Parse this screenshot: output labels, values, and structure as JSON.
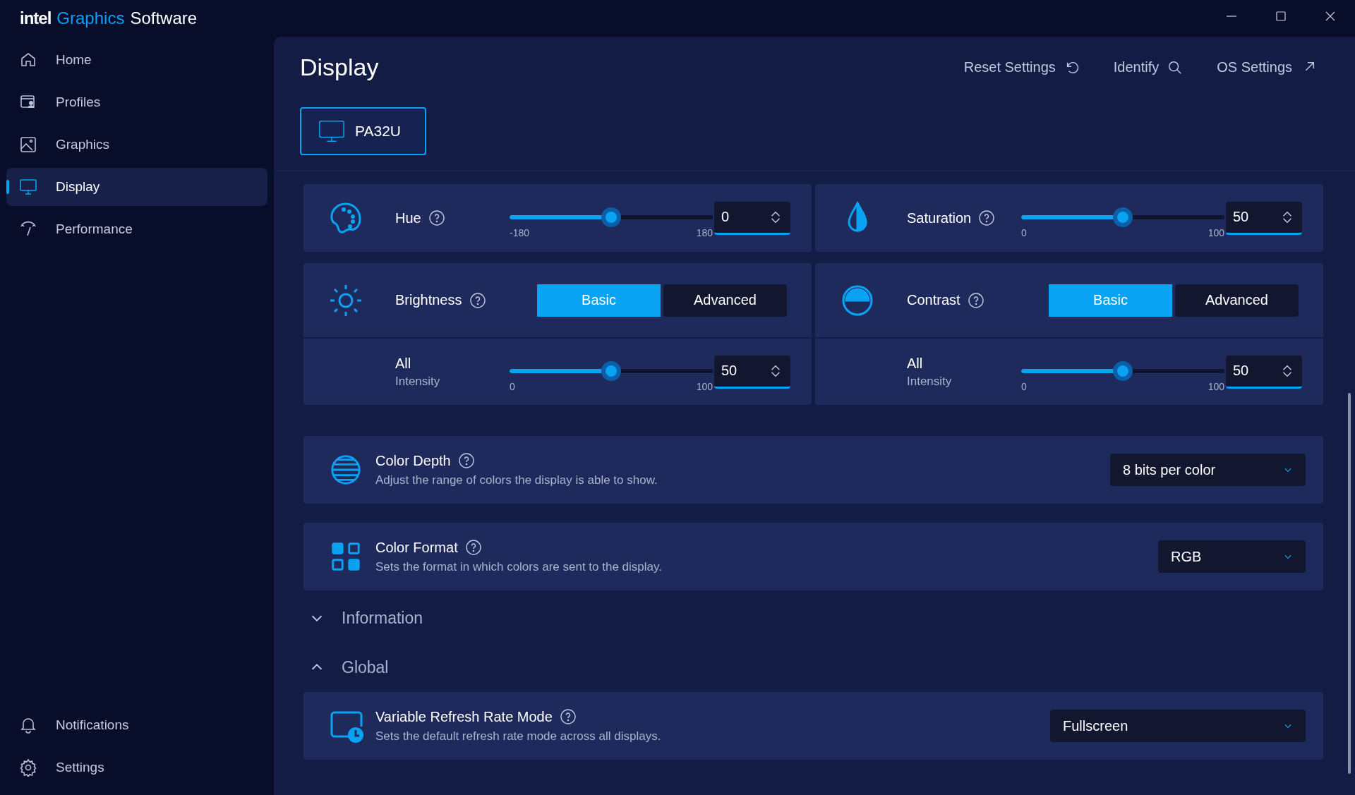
{
  "app": {
    "brand": "intel",
    "accent": "Graphics",
    "rest": "Software"
  },
  "sidebar": {
    "items": [
      {
        "label": "Home",
        "selected": false
      },
      {
        "label": "Profiles",
        "selected": false
      },
      {
        "label": "Graphics",
        "selected": false
      },
      {
        "label": "Display",
        "selected": true
      },
      {
        "label": "Performance",
        "selected": false
      }
    ],
    "bottom_items": [
      {
        "label": "Notifications",
        "selected": false
      },
      {
        "label": "Settings",
        "selected": false
      }
    ]
  },
  "page": {
    "title": "Display",
    "actions": [
      {
        "label": "Reset Settings"
      },
      {
        "label": "Identify"
      },
      {
        "label": "OS Settings"
      }
    ],
    "displays": [
      {
        "label": "PA32U",
        "selected": true
      }
    ]
  },
  "adjustments": [
    {
      "kind": "slider",
      "label": "Hue",
      "min": "-180",
      "max": "180",
      "level": 0.5,
      "value": "0"
    },
    {
      "kind": "slider",
      "label": "Saturation",
      "min": "0",
      "max": "100",
      "level": 0.5,
      "value": "50"
    },
    {
      "kind": "mode",
      "label": "Brightness",
      "modes": [
        {
          "label": "Basic",
          "selected": true
        },
        {
          "label": "Advanced",
          "selected": false
        }
      ],
      "channel": {
        "label": "All",
        "sublabel": "Intensity",
        "min": "0",
        "max": "100",
        "level": 0.5,
        "value": "50"
      }
    },
    {
      "kind": "mode",
      "label": "Contrast",
      "modes": [
        {
          "label": "Basic",
          "selected": true
        },
        {
          "label": "Advanced",
          "selected": false
        }
      ],
      "channel": {
        "label": "All",
        "sublabel": "Intensity",
        "min": "0",
        "max": "100",
        "level": 0.5,
        "value": "50"
      }
    }
  ],
  "settings": [
    {
      "label": "Color Depth",
      "description": "Adjust the range of colors the display is able to show.",
      "value": "8 bits per color"
    },
    {
      "label": "Color Format",
      "description": "Sets the format in which colors are sent to the display.",
      "value": "RGB"
    }
  ],
  "sections": [
    {
      "label": "Information",
      "expanded": false
    },
    {
      "label": "Global",
      "expanded": true,
      "settings": [
        {
          "label": "Variable Refresh Rate Mode",
          "description": "Sets the default refresh rate mode across all displays.",
          "value": "Fullscreen"
        }
      ]
    }
  ]
}
